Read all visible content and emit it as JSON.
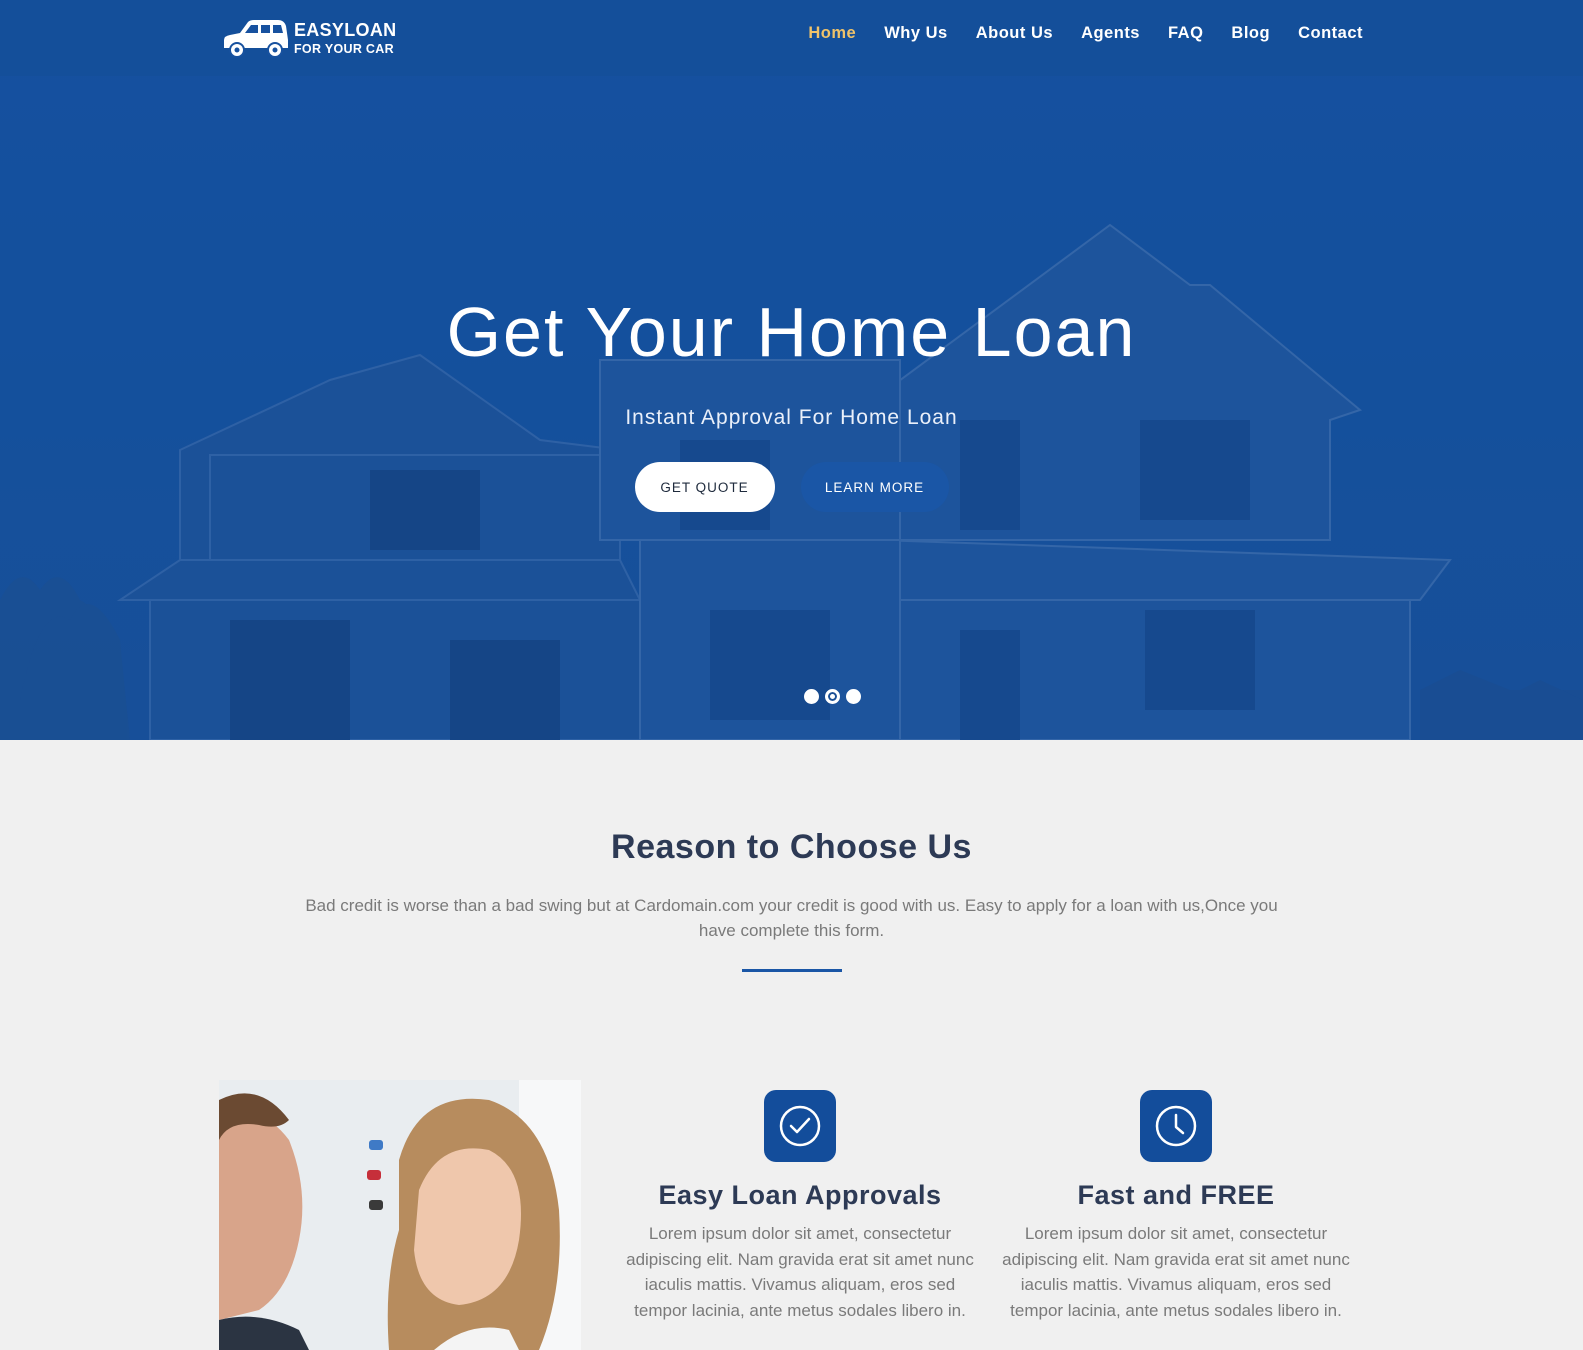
{
  "brand": {
    "line1": "EASYLOAN",
    "line2": "FOR YOUR CAR"
  },
  "nav": {
    "items": [
      {
        "label": "Home",
        "active": true
      },
      {
        "label": "Why Us"
      },
      {
        "label": "About Us"
      },
      {
        "label": "Agents"
      },
      {
        "label": "FAQ"
      },
      {
        "label": "Blog"
      },
      {
        "label": "Contact"
      }
    ]
  },
  "hero": {
    "title": "Get Your Home Loan",
    "subtitle": "Instant Approval For Home Loan",
    "quote_button": "GET QUOTE",
    "learn_button": "LEARN MORE",
    "slides_total": 3,
    "active_slide": 2
  },
  "reason": {
    "title": "Reason to Choose Us",
    "description": "Bad credit is worse than a bad swing but at Cardomain.com your credit is good with us. Easy to apply for a loan with us,Once you have complete this form."
  },
  "features": [
    {
      "icon": "check-circle-icon",
      "title": "Easy Loan Approvals",
      "text": "Lorem ipsum dolor sit amet, consectetur adipiscing elit. Nam gravida erat sit amet nunc iaculis mattis. Vivamus aliquam, eros sed tempor lacinia, ante metus sodales libero in."
    },
    {
      "icon": "clock-icon",
      "title": "Fast and FREE",
      "text": "Lorem ipsum dolor sit amet, consectetur adipiscing elit. Nam gravida erat sit amet nunc iaculis mattis. Vivamus aliquam, eros sed tempor lacinia, ante metus sodales libero in."
    }
  ],
  "colors": {
    "primary": "#134d9b",
    "nav_active": "#f0c36a",
    "heading": "#2d3a55"
  }
}
